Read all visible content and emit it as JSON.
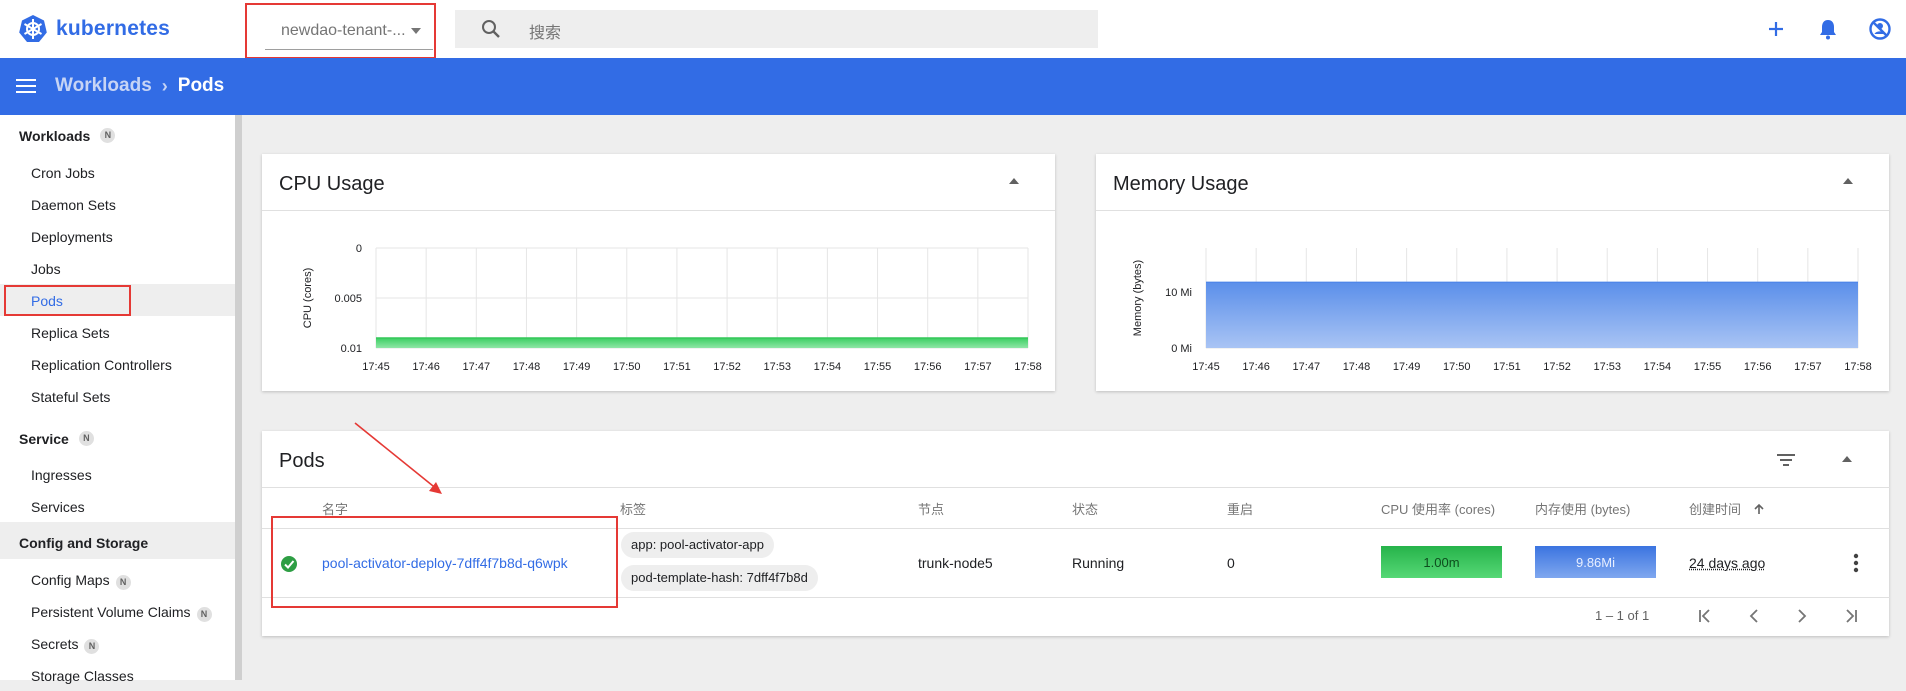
{
  "app": {
    "logo_text": "kubernetes"
  },
  "header": {
    "namespace_value": "newdao-tenant-...",
    "search_placeholder": "搜索"
  },
  "breadcrumb": {
    "parent": "Workloads",
    "current": "Pods"
  },
  "sidebar": {
    "sections": [
      {
        "label": "Workloads",
        "badge": "N",
        "items": [
          "Cron Jobs",
          "Daemon Sets",
          "Deployments",
          "Jobs",
          "Pods",
          "Replica Sets",
          "Replication Controllers",
          "Stateful Sets"
        ]
      },
      {
        "label": "Service",
        "badge": "N",
        "items": [
          "Ingresses",
          "Services"
        ]
      },
      {
        "label": "Config and Storage",
        "badge": "",
        "items": [
          "Config Maps",
          "Persistent Volume Claims",
          "Secrets",
          "Storage Classes"
        ]
      }
    ],
    "item_badges": {
      "Config Maps": "N",
      "Persistent Volume Claims": "N",
      "Secrets": "N"
    }
  },
  "cpu_card": {
    "title": "CPU Usage"
  },
  "memory_card": {
    "title": "Memory Usage"
  },
  "chart_data": [
    {
      "type": "area",
      "title": "CPU Usage",
      "ylabel": "CPU (cores)",
      "xlabel": "",
      "x": [
        "17:45",
        "17:46",
        "17:47",
        "17:48",
        "17:49",
        "17:50",
        "17:51",
        "17:52",
        "17:53",
        "17:54",
        "17:55",
        "17:56",
        "17:57",
        "17:58"
      ],
      "y_ticks": [
        "0",
        "0.005",
        "0.01"
      ],
      "ylim": [
        0,
        0.01
      ],
      "series": [
        {
          "values": [
            0.001,
            0.001,
            0.001,
            0.001,
            0.001,
            0.001,
            0.001,
            0.001,
            0.001,
            0.001,
            0.001,
            0.001,
            0.001,
            0.001
          ]
        }
      ],
      "color": "#34c759",
      "grid": true
    },
    {
      "type": "area",
      "title": "Memory Usage",
      "ylabel": "Memory (bytes)",
      "xlabel": "",
      "x": [
        "17:45",
        "17:46",
        "17:47",
        "17:48",
        "17:49",
        "17:50",
        "17:51",
        "17:52",
        "17:53",
        "17:54",
        "17:55",
        "17:56",
        "17:57",
        "17:58"
      ],
      "y_ticks": [
        "0 Mi",
        "10 Mi"
      ],
      "ylim": [
        0,
        15
      ],
      "series": [
        {
          "values": [
            9.86,
            9.86,
            9.86,
            9.86,
            9.86,
            9.86,
            9.86,
            9.86,
            9.86,
            9.86,
            9.86,
            9.86,
            9.86,
            9.86
          ]
        }
      ],
      "color": "#4f86e8",
      "grid": true
    }
  ],
  "pods_card": {
    "title": "Pods",
    "columns": [
      "名字",
      "标签",
      "节点",
      "状态",
      "重启",
      "CPU 使用率 (cores)",
      "内存使用 (bytes)",
      "创建时间"
    ],
    "rows": [
      {
        "name": "pool-activator-deploy-7dff4f7b8d-q6wpk",
        "labels": [
          "app: pool-activator-app",
          "pod-template-hash: 7dff4f7b8d"
        ],
        "node": "trunk-node5",
        "status": "Running",
        "restarts": "0",
        "cpu": "1.00m",
        "memory": "9.86Mi",
        "created": "24 days ago"
      }
    ],
    "pagination": "1 – 1 of 1"
  },
  "colors": {
    "brand": "#326ce5",
    "running": "#2e9e44",
    "cpu_fill": "#34c759",
    "mem_fill": "#4f86e8",
    "annotation": "#e53935"
  }
}
